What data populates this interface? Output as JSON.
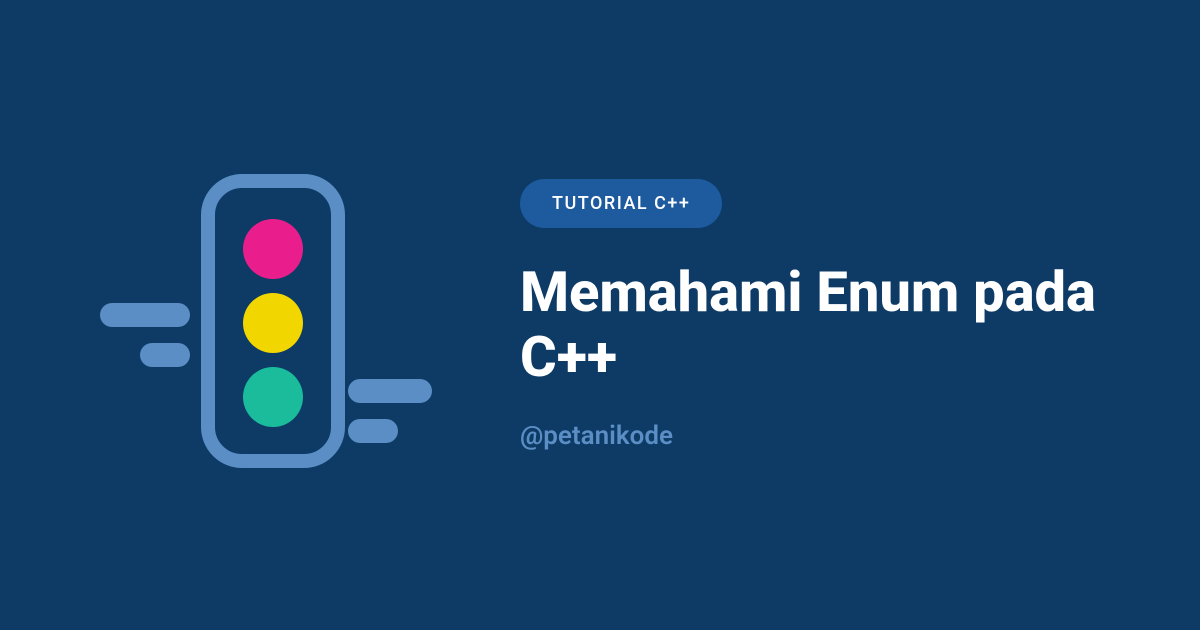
{
  "badge": {
    "label": "TUTORIAL  C++"
  },
  "title": "Memahami Enum pada C++",
  "handle": "@petanikode",
  "illustration": {
    "name": "traffic-light-icon",
    "colors": {
      "frame": "#5a8ec4",
      "bar": "#5a8ec4",
      "light_top": "#e91e8c",
      "light_middle": "#f2d600",
      "light_bottom": "#1abc9c"
    }
  }
}
